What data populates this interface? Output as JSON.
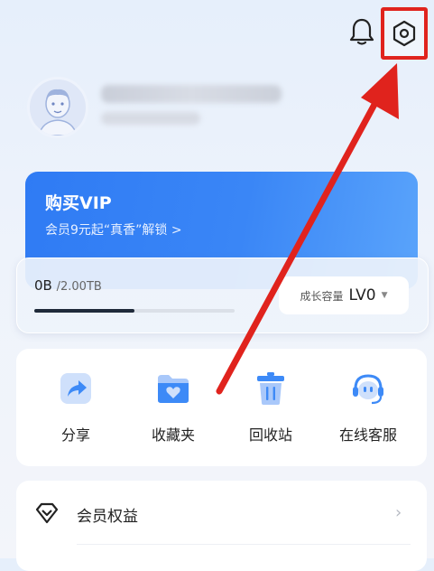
{
  "storage": {
    "used": "0B",
    "total": "/2.00TB",
    "progress_fraction": 0.5,
    "growth_label": "成长容量",
    "level": "LV0"
  },
  "vip": {
    "title": "购买VIP",
    "subtitle": "会员9元起“真香”解锁 >"
  },
  "actions": [
    {
      "label": "分享",
      "icon": "share-icon"
    },
    {
      "label": "收藏夹",
      "icon": "favorites-folder-icon"
    },
    {
      "label": "回收站",
      "icon": "trash-icon"
    },
    {
      "label": "在线客服",
      "icon": "customer-service-icon"
    }
  ],
  "member_row": {
    "label": "会员权益",
    "icon": "diamond-icon",
    "chevron": "›"
  },
  "colors": {
    "accent_blue": "#2f7bf4",
    "highlight_red": "#e0231d",
    "icon_blue": "#3d8af7"
  }
}
